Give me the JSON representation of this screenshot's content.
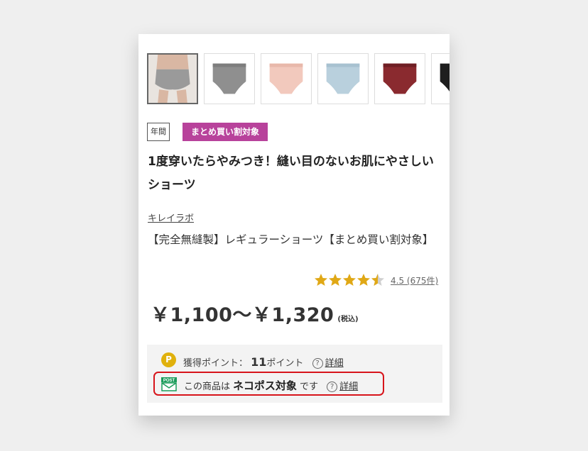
{
  "product": {
    "tags": {
      "year": "年間",
      "bulk": "まとめ買い割対象"
    },
    "catch_copy": "1度穿いたらやみつき！縫い目のないお肌にやさしいショーツ",
    "brand": "キレイラボ",
    "name": "【完全無縫製】レギュラーショーツ【まとめ買い割対象】",
    "rating": {
      "value": 4.5,
      "text": "4.5 (675件)"
    },
    "price": {
      "main": "￥1,100～￥1,320",
      "tax": "(税込)"
    },
    "points": {
      "icon": "P",
      "label": "獲得ポイント：",
      "value": "11",
      "unit": "ポイント",
      "help": "?",
      "detail": "詳細"
    },
    "nekopos": {
      "icon": "POST",
      "prefix": "この商品は",
      "name": "ネコポス対象",
      "suffix": "です",
      "help": "?",
      "detail": "詳細"
    },
    "swatches": [
      {
        "label": "model-photo-thumbnail",
        "color": "#9a9a9a"
      },
      {
        "label": "gray-shorts-thumbnail",
        "color": "#8f8f8f"
      },
      {
        "label": "pink-shorts-thumbnail",
        "color": "#f2c9bd"
      },
      {
        "label": "light-blue-shorts-thumbnail",
        "color": "#b9d0dd"
      },
      {
        "label": "wine-red-shorts-thumbnail",
        "color": "#8a2a2f"
      },
      {
        "label": "black-shorts-thumbnail",
        "color": "#1e1e1e"
      }
    ]
  },
  "colors": {
    "bulk_tag": "#b8429b",
    "star": "#e0a816",
    "point_icon": "#e0b10c",
    "highlight": "#d7141b",
    "nekopos_icon": "#1a9c5a"
  }
}
